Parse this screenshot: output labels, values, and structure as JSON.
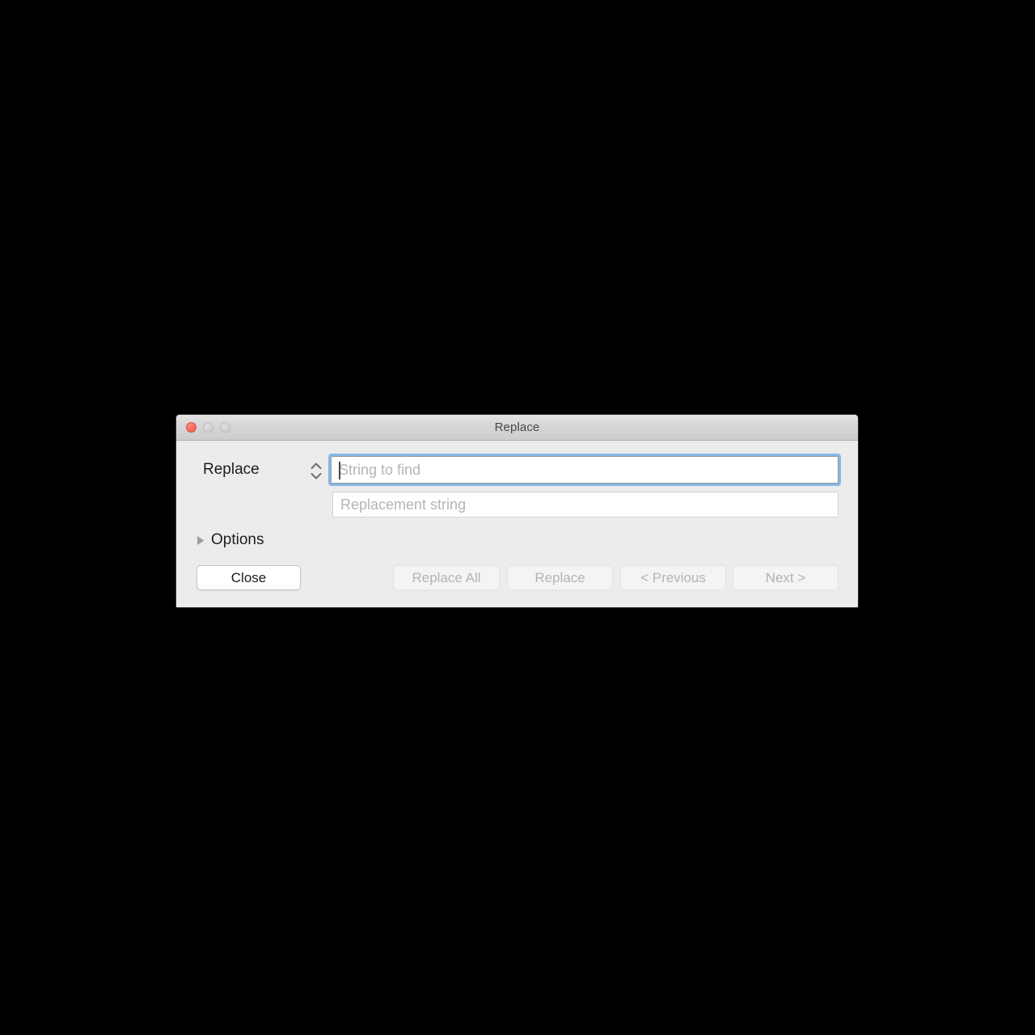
{
  "window": {
    "title": "Replace",
    "traffic_lights": [
      {
        "name": "close",
        "color": "#fa6a5c",
        "enabled": true
      },
      {
        "name": "minimize",
        "color": "#d2d2d2",
        "enabled": false
      },
      {
        "name": "zoom",
        "color": "#d2d2d2",
        "enabled": false
      }
    ]
  },
  "form": {
    "mode_label": "Replace",
    "mode_stepper_icon": "stepper-up-down-icon",
    "find_field": {
      "value": "",
      "placeholder": "String to find",
      "focused": true,
      "caret_visible": true
    },
    "replace_field": {
      "value": "",
      "placeholder": "Replacement string",
      "focused": false
    }
  },
  "options": {
    "label": "Options",
    "expanded": false,
    "disclosure_icon": "disclosure-triangle-right-icon"
  },
  "buttons": [
    {
      "id": "close",
      "label": "Close",
      "enabled": true
    },
    {
      "id": "replace_all",
      "label": "Replace All",
      "enabled": false
    },
    {
      "id": "replace",
      "label": "Replace",
      "enabled": false
    },
    {
      "id": "previous",
      "label": "< Previous",
      "enabled": false
    },
    {
      "id": "next",
      "label": "Next >",
      "enabled": false
    }
  ],
  "colors": {
    "focus_ring": "#86b7e8",
    "window_background": "#ececec",
    "titlebar_background": "#d6d6d6",
    "desktop_background": "#000000",
    "placeholder_text": "#b5b5b5",
    "disabled_text": "#b4b4b4"
  }
}
